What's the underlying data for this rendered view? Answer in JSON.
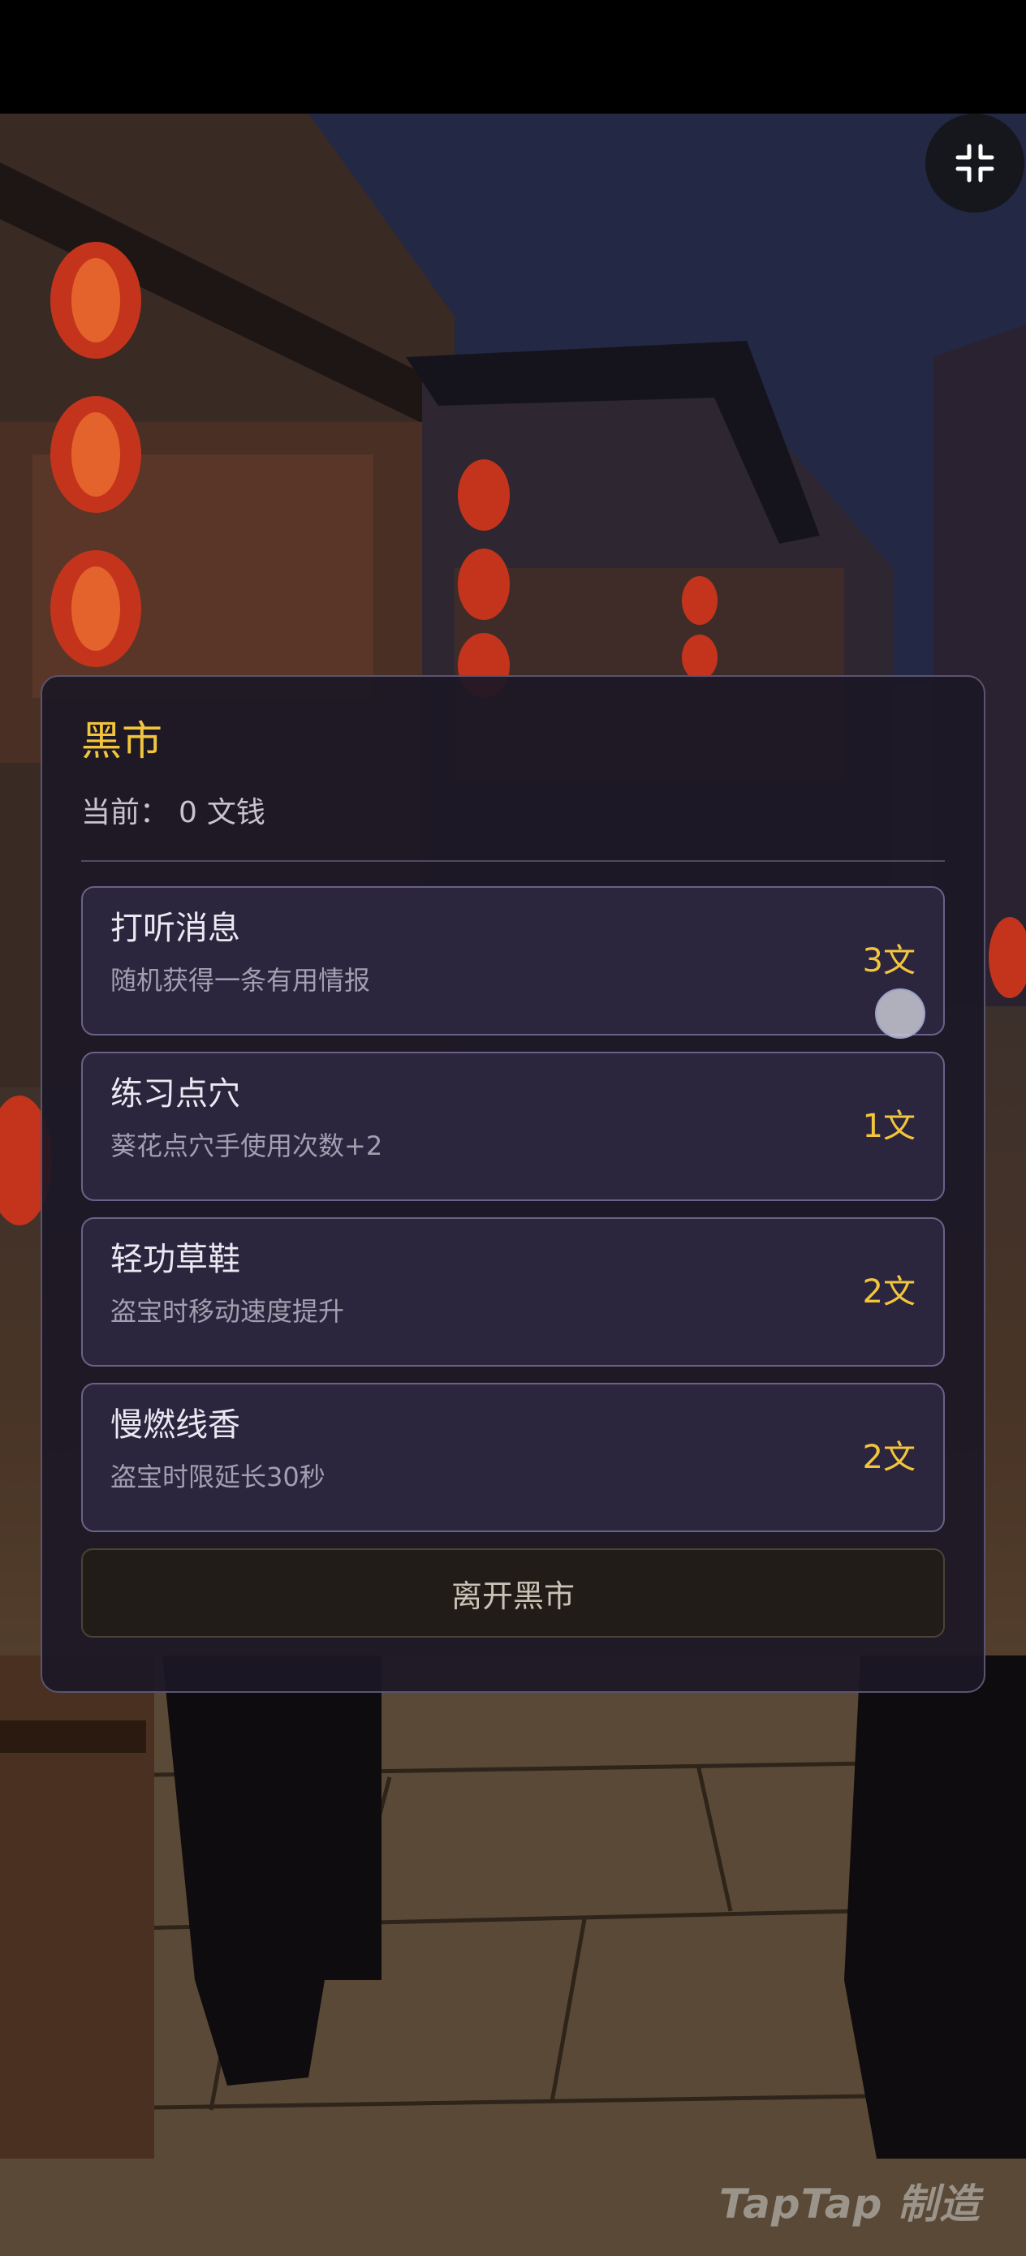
{
  "shop": {
    "title": "黑市",
    "balance_prefix": "当前：",
    "balance_value": "0",
    "balance_unit": "文钱",
    "items": [
      {
        "name": "打听消息",
        "desc": "随机获得一条有用情报",
        "price": "3文"
      },
      {
        "name": "练习点穴",
        "desc": "葵花点穴手使用次数+2",
        "price": "1文"
      },
      {
        "name": "轻功草鞋",
        "desc": "盗宝时移动速度提升",
        "price": "2文"
      },
      {
        "name": "慢燃线香",
        "desc": "盗宝时限延长30秒",
        "price": "2文"
      }
    ],
    "leave_label": "离开黑市"
  },
  "controls": {
    "exit_fullscreen_icon": "exit-fullscreen-icon"
  },
  "watermark": "TapTap 制造",
  "colors": {
    "accent_gold": "#f2c53d",
    "panel_bg": "#1c1826",
    "item_border": "#6a6288",
    "lantern_red": "#c4341c"
  }
}
